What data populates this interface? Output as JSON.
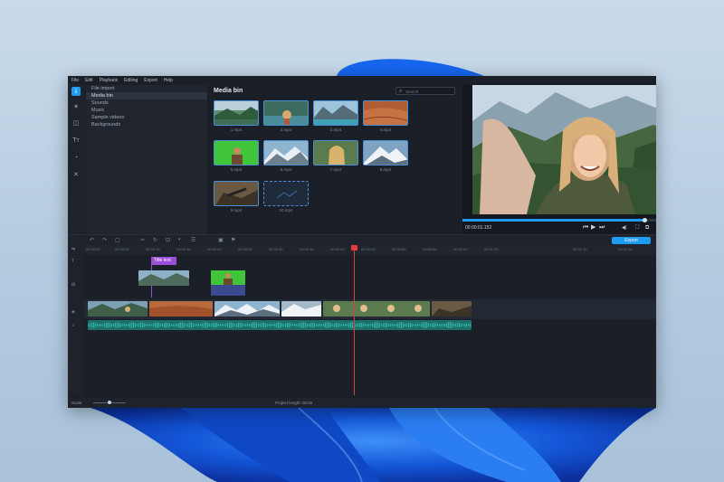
{
  "app": {
    "menu": [
      "File",
      "Edit",
      "Playback",
      "Editing",
      "Export",
      "Help"
    ],
    "iconbar": [
      {
        "name": "import-icon",
        "glyph": "⤓"
      },
      {
        "name": "filters-icon",
        "glyph": "✶"
      },
      {
        "name": "transitions-icon",
        "glyph": "◫"
      },
      {
        "name": "titles-icon",
        "glyph": "Tт"
      },
      {
        "name": "stickers-icon",
        "glyph": "◔"
      },
      {
        "name": "more-tools-icon",
        "glyph": "✕"
      }
    ],
    "nav": [
      "File import",
      "Media bin",
      "Sounds",
      "Music",
      "Sample videos",
      "Backgrounds"
    ],
    "media_title": "Media bin",
    "search_placeholder": "Search",
    "thumbs": [
      "1.mp4",
      "2.mp4",
      "3.mp4",
      "4.mp4",
      "5.mp4",
      "6.mp4",
      "7.mp4",
      "8.mp4",
      "9.mp4",
      "10.mp4"
    ],
    "timecode": "00:00:01.152",
    "export_label": "Export",
    "ruler": [
      "00:00:00",
      "00:00:05",
      "00:00:10",
      "00:00:15",
      "00:00:20",
      "00:00:25",
      "00:00:30",
      "00:00:35",
      "00:00:40",
      "00:00:45",
      "00:00:50",
      "00:00:55",
      "00:01:00",
      "00:01:05",
      "00:01:10",
      "00:01:15"
    ],
    "title_clip": "Title text",
    "scale_label": "Scale:",
    "project_length": "Project length: 00:55",
    "progress": 0.94,
    "colors": {
      "accent": "#1f9bf0",
      "playhead": "#e23d3d",
      "audio": "#2bb3a3"
    }
  }
}
